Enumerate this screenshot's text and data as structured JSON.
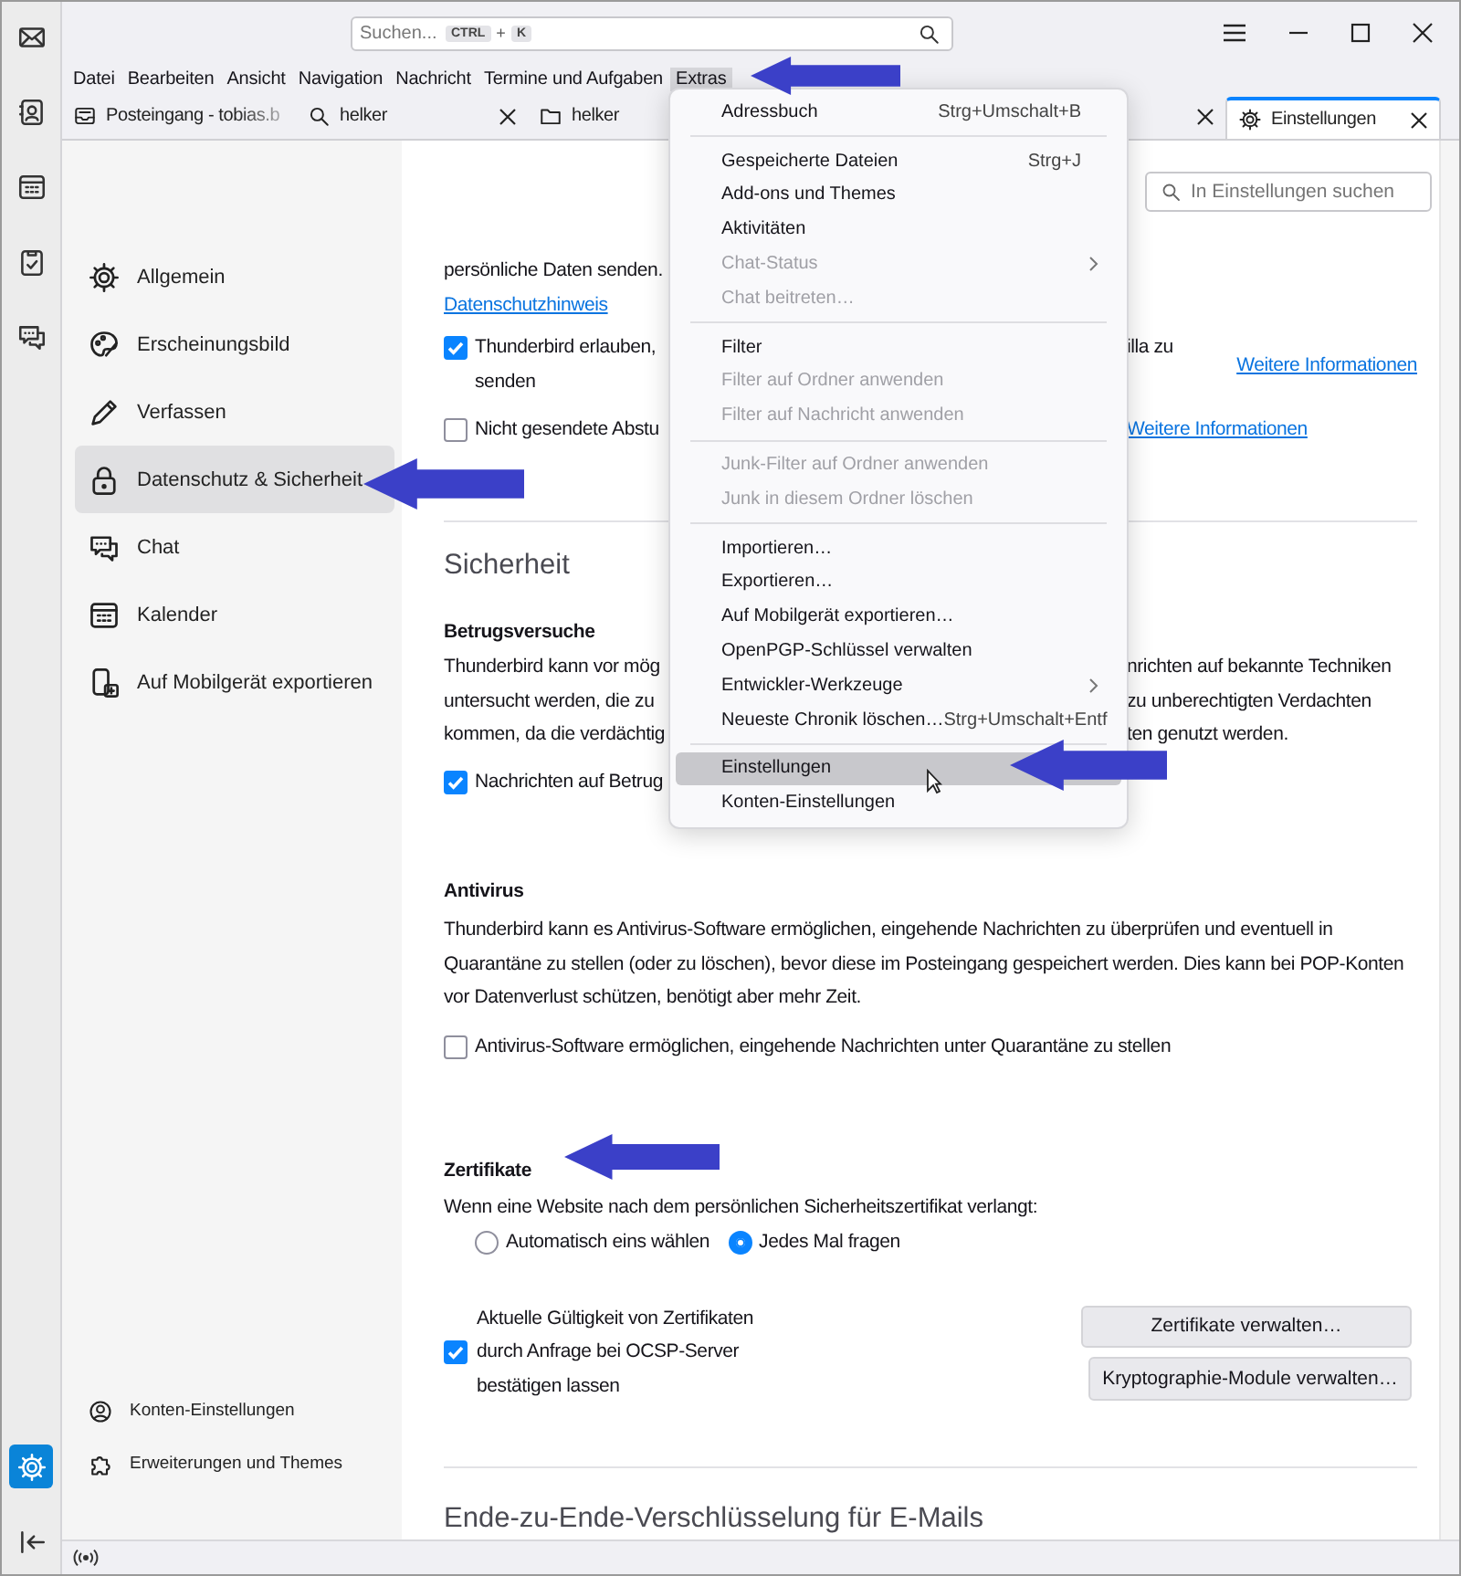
{
  "spaces": {
    "top": [
      {
        "selected": false
      },
      {
        "selected": false
      },
      {
        "selected": false
      },
      {
        "selected": false
      },
      {
        "selected": false
      }
    ],
    "bottom": [
      {
        "selected": true
      },
      {
        "selected": false
      }
    ]
  },
  "search": {
    "placeholder": "Suchen...",
    "keys": [
      "CTRL",
      "K"
    ],
    "joiner": "+"
  },
  "menubar": [
    {
      "label": "Datei",
      "selected": false
    },
    {
      "label": "Bearbeiten",
      "selected": false
    },
    {
      "label": "Ansicht",
      "selected": false
    },
    {
      "label": "Navigation",
      "selected": false
    },
    {
      "label": "Nachricht",
      "selected": false
    },
    {
      "label": "Termine und Aufgaben",
      "selected": false
    },
    {
      "label": "Extras",
      "selected": true
    }
  ],
  "tabs": [
    {
      "label": "Posteingang - tobias.b",
      "selected": false,
      "closable": false
    },
    {
      "label": "helker",
      "selected": false,
      "closable": true
    },
    {
      "label": "helker",
      "selected": false,
      "closable": true
    },
    {
      "label": "Einstellungen",
      "selected": true,
      "closable": true
    }
  ],
  "settings_nav": {
    "items": [
      {
        "label": "Allgemein",
        "selected": false
      },
      {
        "label": "Erscheinungsbild",
        "selected": false
      },
      {
        "label": "Verfassen",
        "selected": false
      },
      {
        "label": "Datenschutz & Sicherheit",
        "selected": true
      },
      {
        "label": "Chat",
        "selected": false
      },
      {
        "label": "Kalender",
        "selected": false
      },
      {
        "label": "Auf Mobilgerät exportieren",
        "selected": false
      }
    ],
    "footer": [
      "Konten-Einstellungen",
      "Erweiterungen und Themes"
    ]
  },
  "settings_search": {
    "placeholder": "In Einstellungen suchen"
  },
  "privacy": {
    "text": "persönliche Daten senden.",
    "link": "Datenschutzhinweis",
    "options": [
      {
        "checked": true,
        "lines": [
          {
            "left": "Thunderbird erlauben,",
            "right": "illa zu"
          },
          {
            "left": "senden"
          }
        ],
        "link": "Weitere Informationen"
      },
      {
        "checked": false,
        "lines": [
          {
            "left": "Nicht gesendete Abstu"
          }
        ],
        "link": "Weitere Informationen"
      }
    ]
  },
  "security": {
    "heading": "Sicherheit",
    "fraud": {
      "title": "Betrugsversuche",
      "lines": [
        {
          "left": "Thunderbird kann vor mög",
          "right": "nrichten auf bekannte Techniken"
        },
        {
          "left": "untersucht werden, die zu",
          "right": "zu unberechtigten Verdachten"
        },
        {
          "left": "kommen, da die verdächtig",
          "right": "ten genutzt werden."
        }
      ],
      "checkbox": {
        "checked": true,
        "label": "Nachrichten auf Betrug"
      }
    },
    "antivirus": {
      "title": "Antivirus",
      "text": "Thunderbird kann es Antivirus-Software ermöglichen, eingehende Nachrichten zu überprüfen und eventuell in Quarantäne zu stellen (oder zu löschen), bevor diese im Posteingang gespeichert werden. Dies kann bei POP-Konten vor Datenverlust schützen, benötigt aber mehr Zeit.",
      "checkbox": {
        "checked": false,
        "label": "Antivirus-Software ermöglichen, eingehende Nachrichten unter Quarantäne zu stellen"
      }
    },
    "certificates": {
      "title": "Zertifikate",
      "prompt": "Wenn eine Website nach dem persönlichen Sicherheitszertifikat verlangt:",
      "choices": [
        {
          "label": "Automatisch eins wählen",
          "selected": false
        },
        {
          "label": "Jedes Mal fragen",
          "selected": true
        }
      ],
      "ocsp": {
        "checked": true,
        "label": "Aktuelle Gültigkeit von Zertifikaten durch Anfrage bei OCSP-Server bestätigen lassen"
      },
      "buttons": [
        "Zertifikate verwalten…",
        "Kryptographie-Module verwalten…"
      ]
    },
    "e2e_heading": "Ende-zu-Ende-Verschlüsselung für E-Mails"
  },
  "extras_menu": {
    "groups": [
      [
        {
          "label": "Adressbuch",
          "shortcut": "Strg+Umschalt+B",
          "disabled": false,
          "submenu": false,
          "selected": false
        }
      ],
      [
        {
          "label": "Gespeicherte Dateien",
          "shortcut": "Strg+J",
          "disabled": false,
          "submenu": false,
          "selected": false
        },
        {
          "label": "Add-ons und Themes",
          "disabled": false,
          "submenu": false,
          "selected": false
        },
        {
          "label": "Aktivitäten",
          "disabled": false,
          "submenu": false,
          "selected": false
        },
        {
          "label": "Chat-Status",
          "disabled": true,
          "submenu": true,
          "selected": false
        },
        {
          "label": "Chat beitreten…",
          "disabled": true,
          "submenu": false,
          "selected": false
        }
      ],
      [
        {
          "label": "Filter",
          "disabled": false,
          "submenu": false,
          "selected": false
        },
        {
          "label": "Filter auf Ordner anwenden",
          "disabled": true,
          "submenu": false,
          "selected": false
        },
        {
          "label": "Filter auf Nachricht anwenden",
          "disabled": true,
          "submenu": false,
          "selected": false
        }
      ],
      [
        {
          "label": "Junk-Filter auf Ordner anwenden",
          "disabled": true,
          "submenu": false,
          "selected": false
        },
        {
          "label": "Junk in diesem Ordner löschen",
          "disabled": true,
          "submenu": false,
          "selected": false
        }
      ],
      [
        {
          "label": "Importieren…",
          "disabled": false,
          "submenu": false,
          "selected": false
        },
        {
          "label": "Exportieren…",
          "disabled": false,
          "submenu": false,
          "selected": false
        },
        {
          "label": "Auf Mobilgerät exportieren…",
          "disabled": false,
          "submenu": false,
          "selected": false
        },
        {
          "label": "OpenPGP-Schlüssel verwalten",
          "disabled": false,
          "submenu": false,
          "selected": false
        },
        {
          "label": "Entwickler-Werkzeuge",
          "disabled": false,
          "submenu": true,
          "selected": false
        },
        {
          "label": "Neueste Chronik löschen…",
          "shortcut": "Strg+Umschalt+Entf",
          "disabled": false,
          "submenu": false,
          "selected": false
        }
      ],
      [
        {
          "label": "Einstellungen",
          "disabled": false,
          "submenu": false,
          "selected": true
        },
        {
          "label": "Konten-Einstellungen",
          "disabled": false,
          "submenu": false,
          "selected": false
        }
      ]
    ]
  }
}
